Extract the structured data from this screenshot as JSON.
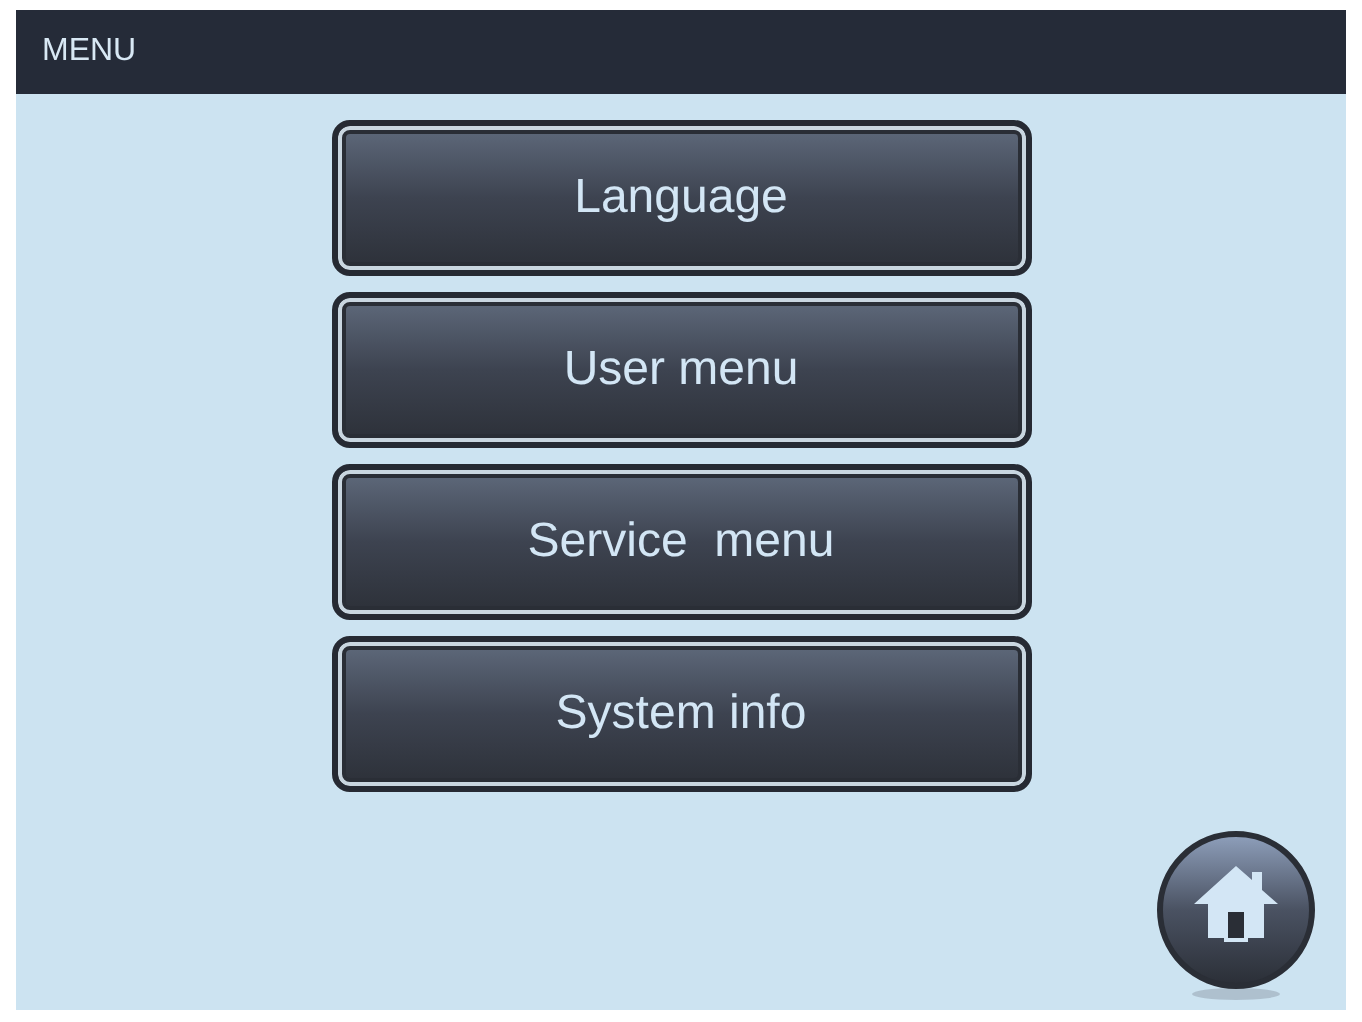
{
  "header": {
    "title": "MENU"
  },
  "menu_buttons": [
    {
      "label": "Language"
    },
    {
      "label": "User menu"
    },
    {
      "label": "Service  menu"
    },
    {
      "label": "System info"
    }
  ]
}
